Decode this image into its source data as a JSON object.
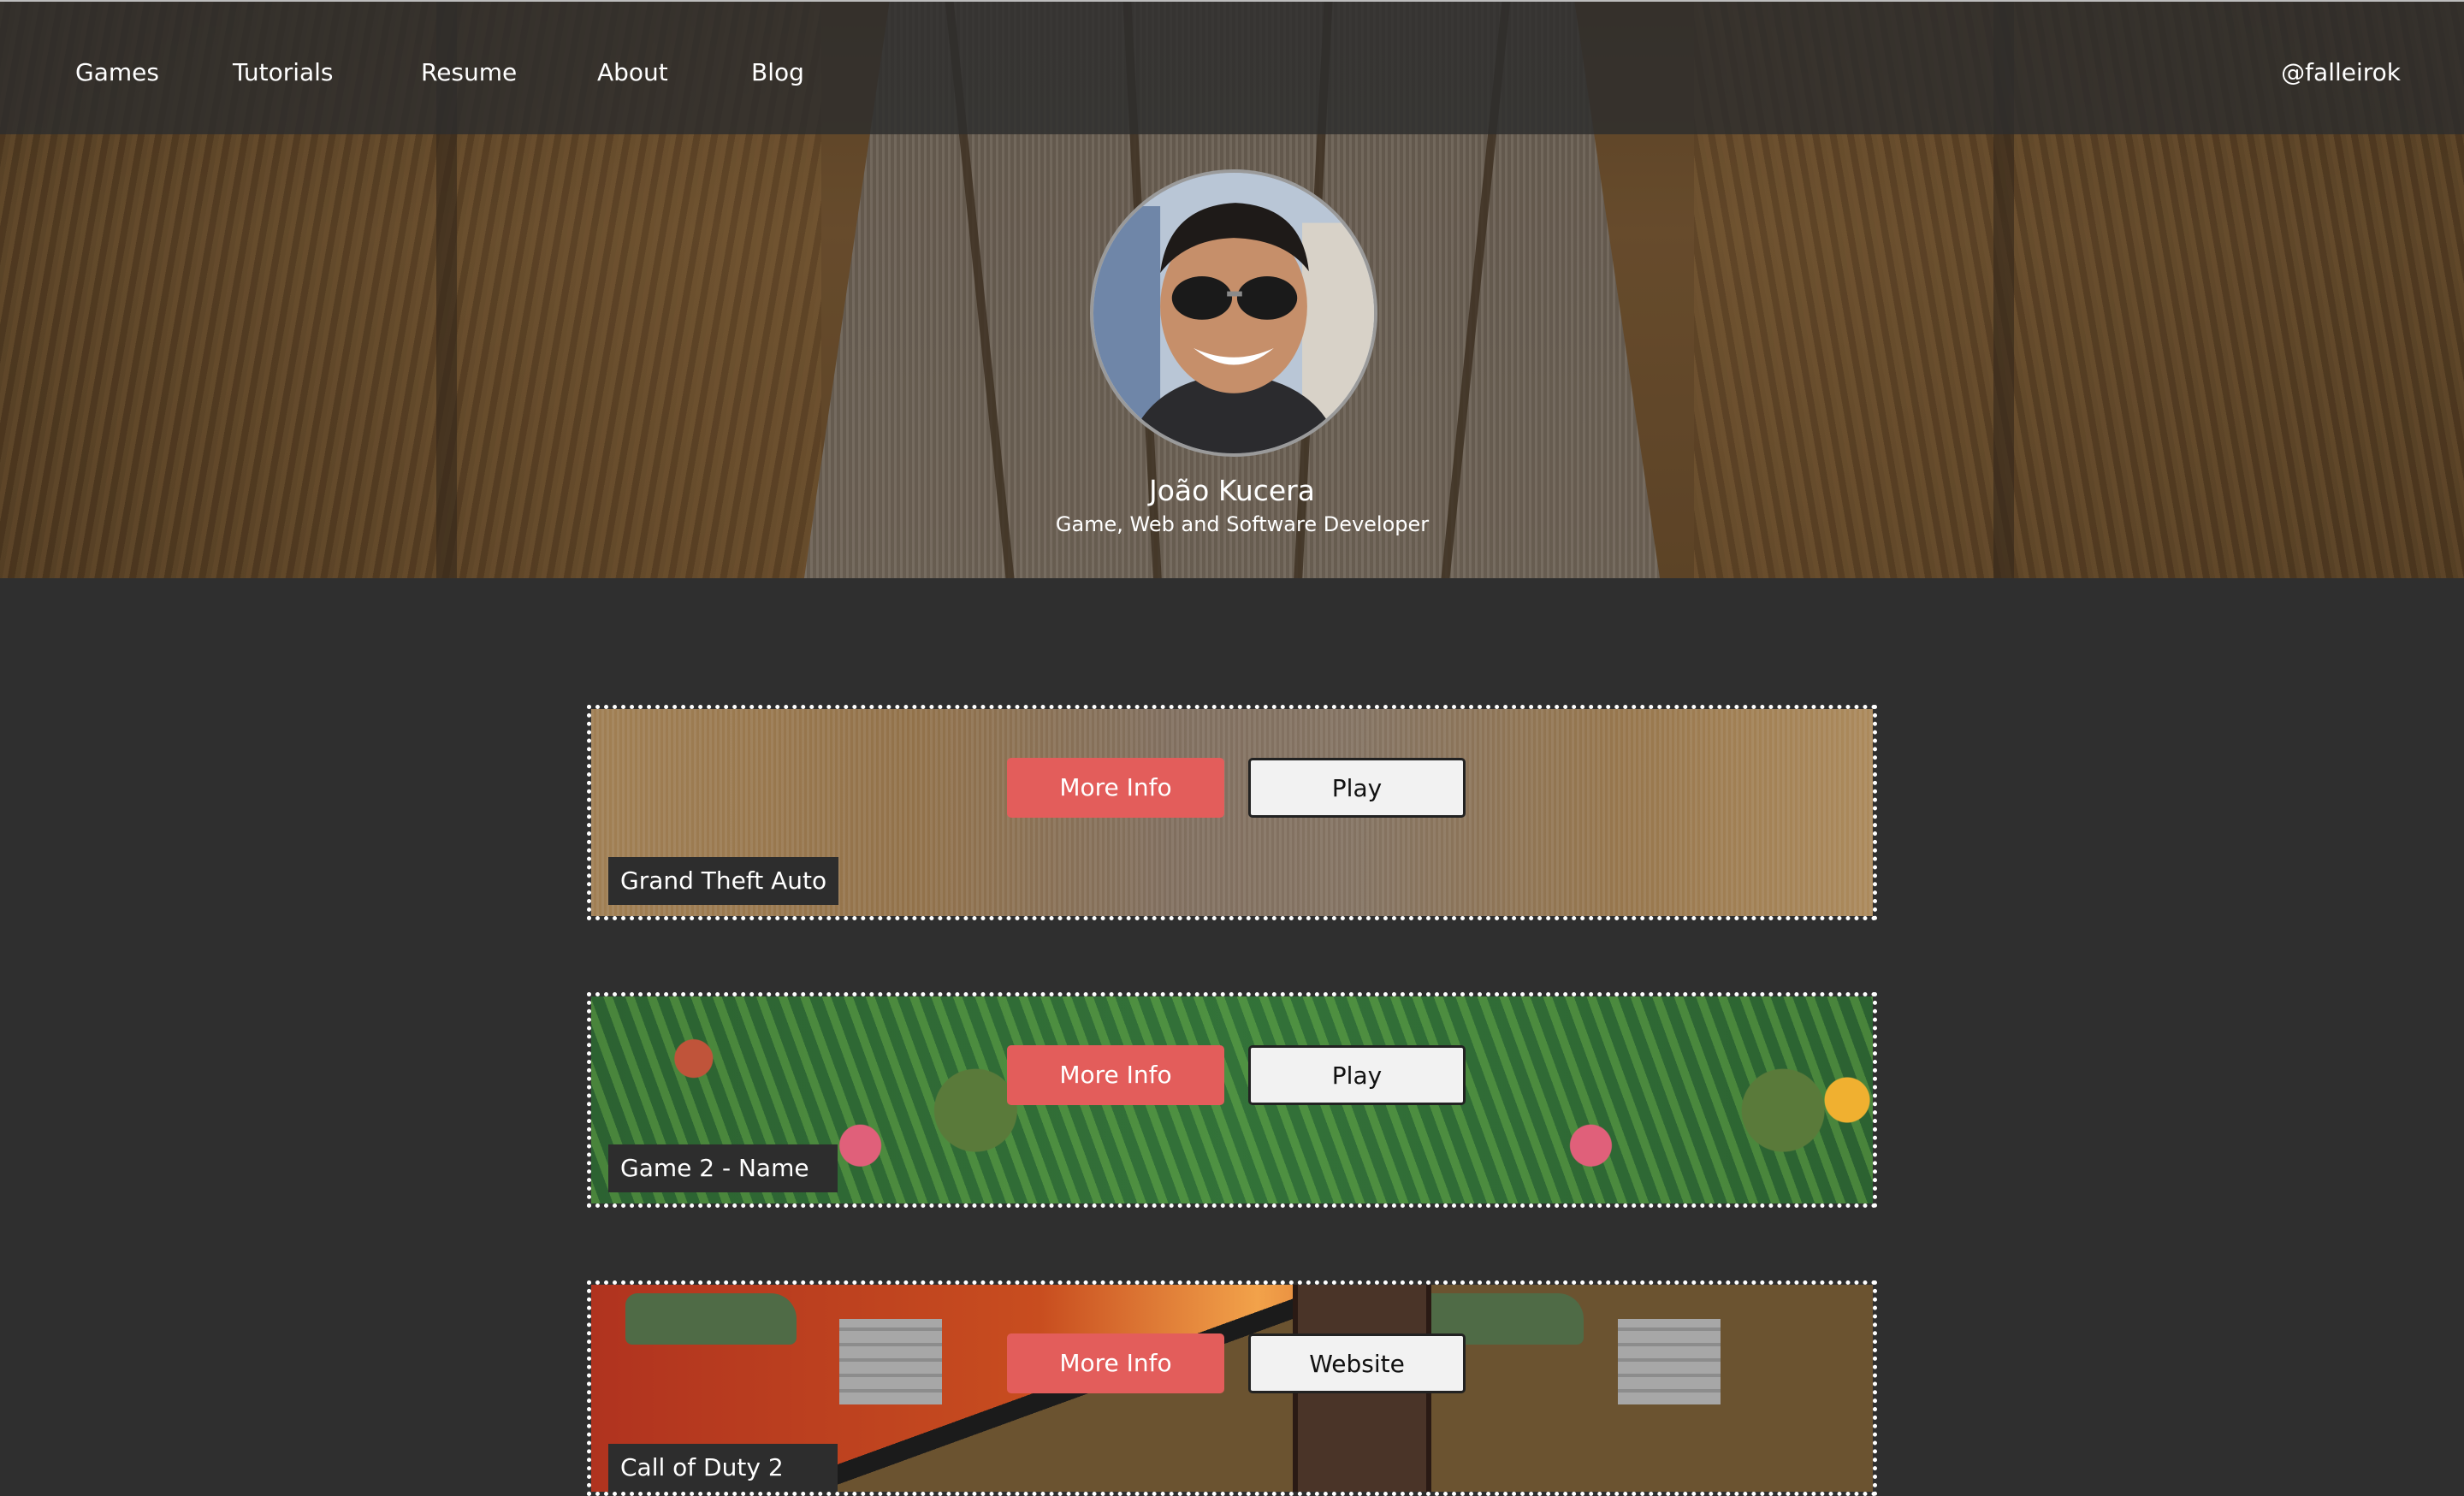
{
  "nav": {
    "items": [
      "Games",
      "Tutorials",
      "Resume",
      "About",
      "Blog"
    ],
    "handle": "@falleirok"
  },
  "profile": {
    "name": "João Kucera",
    "role": "Game, Web and Software Developer"
  },
  "games": [
    {
      "title": "Grand Theft Auto",
      "info_label": "More Info",
      "action_label": "Play"
    },
    {
      "title": "Game 2 - Name",
      "info_label": "More Info",
      "action_label": "Play"
    },
    {
      "title": "Call of Duty 2",
      "info_label": "More Info",
      "action_label": "Website"
    }
  ],
  "colors": {
    "background": "#2f2f2f",
    "topbar": "#2d2d2d",
    "accent_button": "#e35d5b",
    "secondary_button": "#f2f2f2"
  }
}
